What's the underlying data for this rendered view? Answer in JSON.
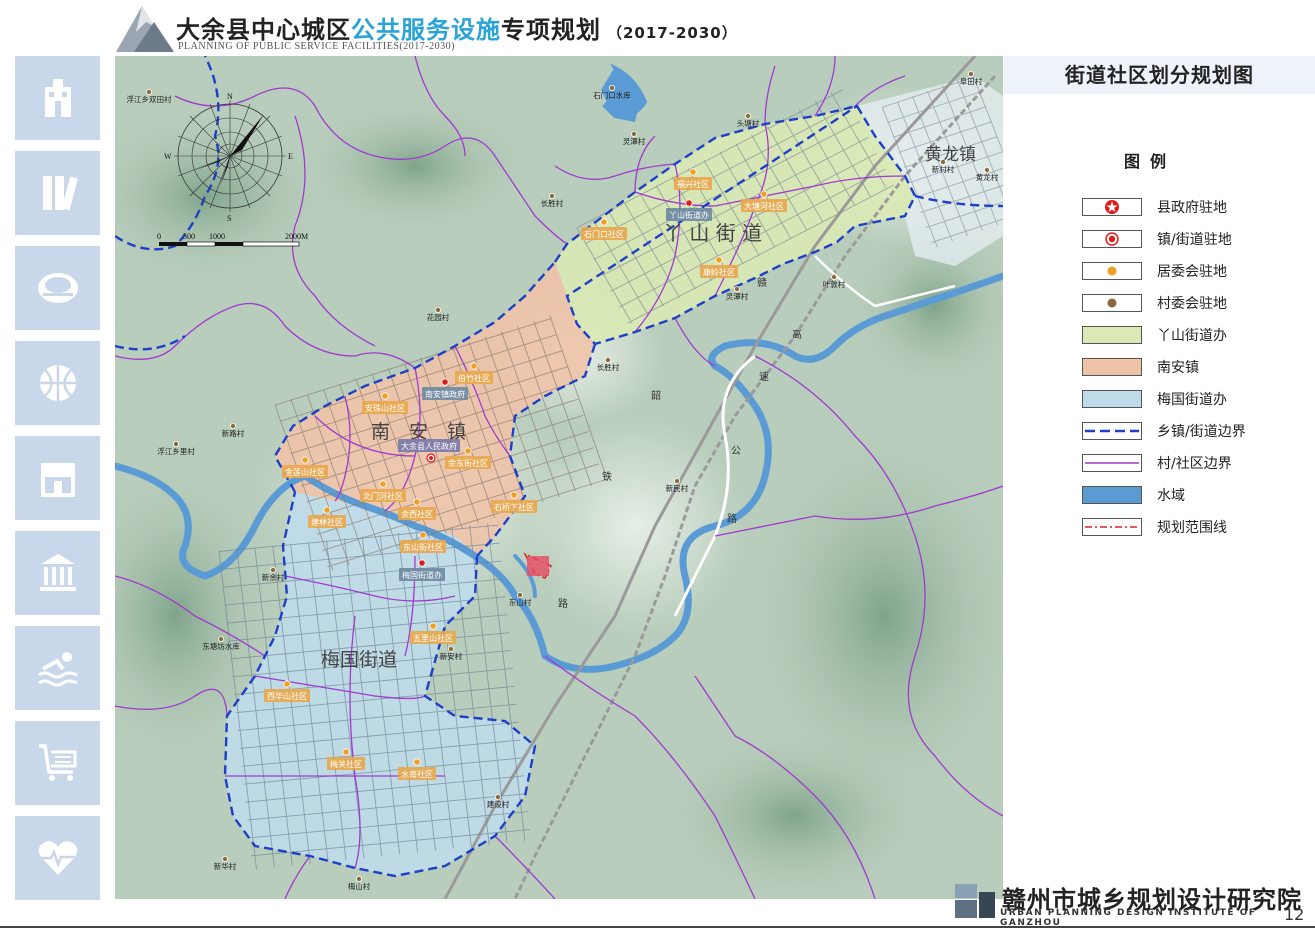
{
  "header": {
    "title_prefix": "大余县中心城区",
    "title_highlight": "公共服务设施",
    "title_suffix": "专项规划",
    "title_years": "（2017-2030）",
    "subtitle": "PLANNING OF PUBLIC SERVICE FACILITIES(2017-2030)"
  },
  "sidebar": {
    "icons": [
      "hospital-icon",
      "books-icon",
      "stadium-icon",
      "basketball-icon",
      "shop-icon",
      "museum-icon",
      "swimming-icon",
      "cart-icon",
      "heart-icon"
    ]
  },
  "map": {
    "compass": {
      "n": "N",
      "s": "S",
      "e": "E",
      "w": "W"
    },
    "scale": {
      "t0": "0",
      "t1": "500",
      "t2": "1000",
      "t3": "2000M"
    },
    "areas": {
      "yashan": "丫 山 街 道",
      "nanan": "南　安　镇",
      "meiguo": "梅国街道",
      "huanglong": "黄龙镇"
    },
    "gov_label": "大余县人民政府",
    "offices": [
      "丫山街道办",
      "南安镇政府",
      "梅国街道办"
    ],
    "communities": [
      "福兴社区",
      "大塘河社区",
      "石门口社区",
      "康岭社区",
      "伯竹社区",
      "安珠山社区",
      "金莲山社区",
      "余东街社区",
      "北门河社区",
      "余西社区",
      "石桥下社区",
      "建林社区",
      "东山街社区",
      "五里山社区",
      "西华山社区",
      "梅关社区",
      "水南社区"
    ],
    "villages": [
      "浮江乡双田村",
      "石门口水库",
      "头塘村",
      "灵潭村",
      "长胜村",
      "新村村",
      "黄龙村",
      "叶敦村",
      "灵潭村",
      "花园村",
      "长胜村",
      "新路村",
      "浮江乡里村",
      "新民村",
      "新余村",
      "东塘坊水库",
      "东山村",
      "新安村",
      "建设村",
      "新华村",
      "梅山村",
      "阜田村"
    ],
    "road_chars": [
      "赣",
      "韶",
      "高",
      "速",
      "公",
      "路",
      "铁",
      "路"
    ]
  },
  "panel": {
    "title": "街道社区划分规划图",
    "legend_title": "图例",
    "legend": [
      {
        "label": "县政府驻地",
        "type": "star"
      },
      {
        "label": "镇/街道驻地",
        "type": "circle-red"
      },
      {
        "label": "居委会驻地",
        "type": "dot-orange"
      },
      {
        "label": "村委会驻地",
        "type": "dot-brown"
      },
      {
        "label": "丫山街道办",
        "type": "fill-green"
      },
      {
        "label": "南安镇",
        "type": "fill-peach"
      },
      {
        "label": "梅国街道办",
        "type": "fill-blue"
      },
      {
        "label": "乡镇/街道边界",
        "type": "dash-blue"
      },
      {
        "label": "村/社区边界",
        "type": "line-purple"
      },
      {
        "label": "水域",
        "type": "fill-water"
      },
      {
        "label": "规划范围线",
        "type": "dashdot-red"
      }
    ]
  },
  "footer": {
    "institute_cn": "赣州市城乡规划设计研究院",
    "institute_en": "URBAN PLANNING DESIGN INSTITUTE OF GANZHOU",
    "page": "12"
  },
  "colors": {
    "green": "#dbe9b4",
    "peach": "#eec3a8",
    "blue": "#bfdbea",
    "water": "#5b9bd5",
    "boundary": "#1e3fc8",
    "village": "#a03ad0"
  }
}
